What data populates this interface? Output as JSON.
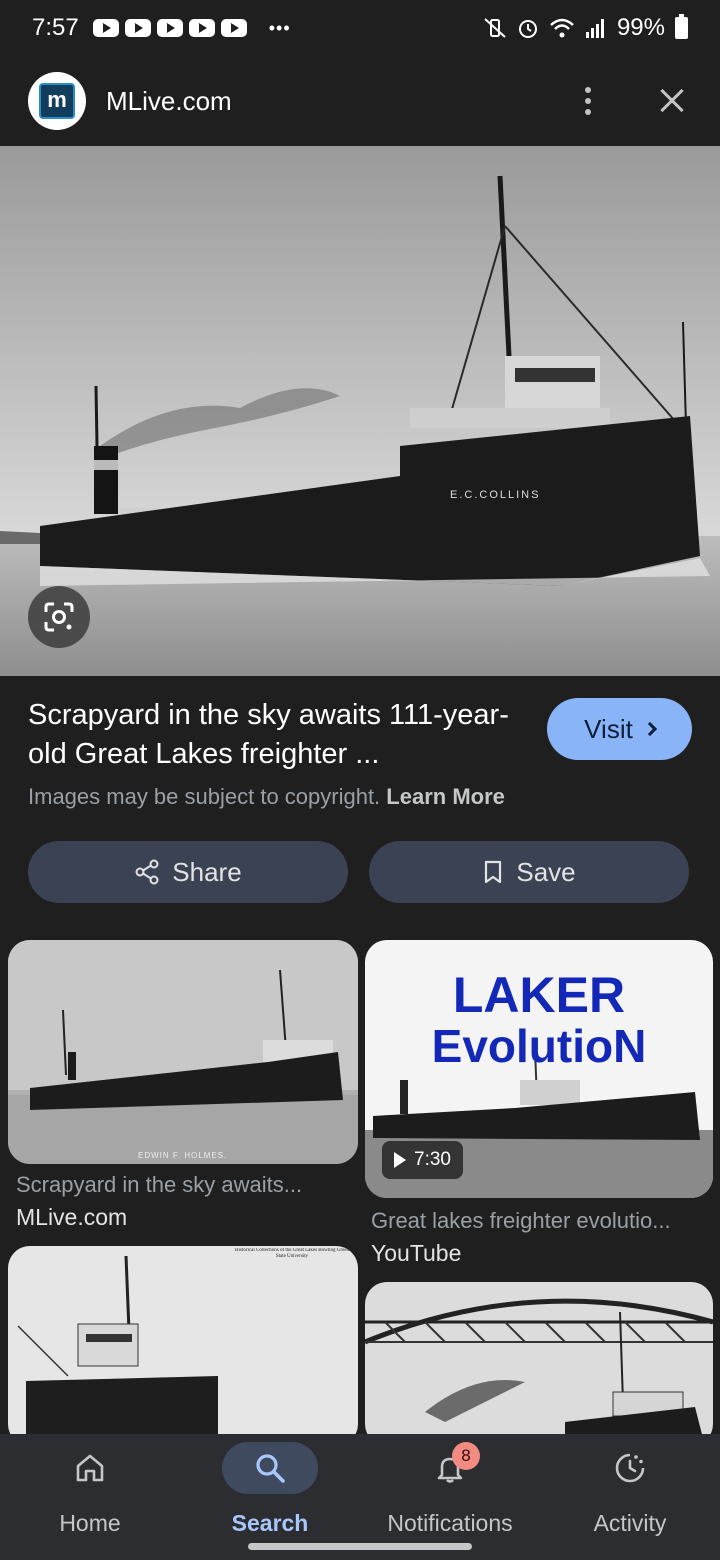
{
  "status_bar": {
    "time": "7:57",
    "battery": "99%",
    "overflow": "•••"
  },
  "header": {
    "site_name": "MLive.com",
    "logo_text": "m"
  },
  "hero": {
    "ship_name": "E.C.COLLINS"
  },
  "result": {
    "title": "Scrapyard in the sky awaits 111-year-old Great Lakes freighter ...",
    "visit_label": "Visit",
    "copyright_text": "Images may be subject to copyright.",
    "learn_more": "Learn More",
    "share_label": "Share",
    "save_label": "Save"
  },
  "related": [
    {
      "title": "Scrapyard in the sky awaits...",
      "source": "MLive.com",
      "caption": "EDWIN F. HOLMES."
    },
    {
      "title": "Great lakes freighter evolutio...",
      "source": "YouTube",
      "duration": "7:30",
      "overlay_line1": "LAKER",
      "overlay_line2": "EvolutioN"
    },
    {
      "title": "",
      "source": "",
      "caption": "Historical Collections of the Great Lakes Bowling Green State University"
    },
    {
      "title": "",
      "source": ""
    }
  ],
  "nav": {
    "home": "Home",
    "search": "Search",
    "notifications": "Notifications",
    "notifications_badge": "8",
    "activity": "Activity"
  }
}
